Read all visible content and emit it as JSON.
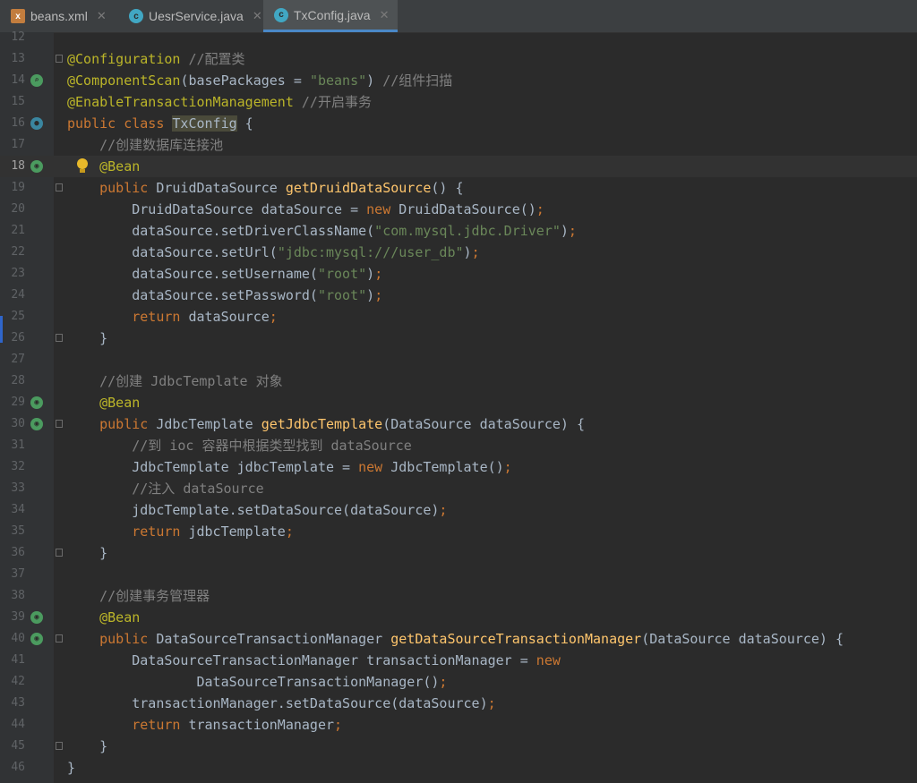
{
  "tabs": [
    {
      "label": "beans.xml",
      "icon": "xml-file-icon",
      "active": false
    },
    {
      "label": "UesrService.java",
      "icon": "class-icon",
      "active": false
    },
    {
      "label": "TxConfig.java",
      "icon": "class-icon",
      "active": true
    }
  ],
  "current_line": "18",
  "lines": [
    {
      "n": "12",
      "t": ""
    },
    {
      "n": "13",
      "t": "@Configuration //配置类"
    },
    {
      "n": "14",
      "t": "@ComponentScan(basePackages = \"beans\") //组件扫描"
    },
    {
      "n": "15",
      "t": "@EnableTransactionManagement //开启事务"
    },
    {
      "n": "16",
      "t": "public class TxConfig {"
    },
    {
      "n": "17",
      "t": "    //创建数据库连接池"
    },
    {
      "n": "18",
      "t": "    @Bean"
    },
    {
      "n": "19",
      "t": "    public DruidDataSource getDruidDataSource() {"
    },
    {
      "n": "20",
      "t": "        DruidDataSource dataSource = new DruidDataSource();"
    },
    {
      "n": "21",
      "t": "        dataSource.setDriverClassName(\"com.mysql.jdbc.Driver\");"
    },
    {
      "n": "22",
      "t": "        dataSource.setUrl(\"jdbc:mysql:///user_db\");"
    },
    {
      "n": "23",
      "t": "        dataSource.setUsername(\"root\");"
    },
    {
      "n": "24",
      "t": "        dataSource.setPassword(\"root\");"
    },
    {
      "n": "25",
      "t": "        return dataSource;"
    },
    {
      "n": "26",
      "t": "    }"
    },
    {
      "n": "27",
      "t": ""
    },
    {
      "n": "28",
      "t": "    //创建 JdbcTemplate 对象"
    },
    {
      "n": "29",
      "t": "    @Bean"
    },
    {
      "n": "30",
      "t": "    public JdbcTemplate getJdbcTemplate(DataSource dataSource) {"
    },
    {
      "n": "31",
      "t": "        //到 ioc 容器中根据类型找到 dataSource"
    },
    {
      "n": "32",
      "t": "        JdbcTemplate jdbcTemplate = new JdbcTemplate();"
    },
    {
      "n": "33",
      "t": "        //注入 dataSource"
    },
    {
      "n": "34",
      "t": "        jdbcTemplate.setDataSource(dataSource);"
    },
    {
      "n": "35",
      "t": "        return jdbcTemplate;"
    },
    {
      "n": "36",
      "t": "    }"
    },
    {
      "n": "37",
      "t": ""
    },
    {
      "n": "38",
      "t": "    //创建事务管理器"
    },
    {
      "n": "39",
      "t": "    @Bean"
    },
    {
      "n": "40",
      "t": "    public DataSourceTransactionManager getDataSourceTransactionManager(DataSource dataSource) {"
    },
    {
      "n": "41",
      "t": "        DataSourceTransactionManager transactionManager = new"
    },
    {
      "n": "42",
      "t": "                DataSourceTransactionManager();"
    },
    {
      "n": "43",
      "t": "        transactionManager.setDataSource(dataSource);"
    },
    {
      "n": "44",
      "t": "        return transactionManager;"
    },
    {
      "n": "45",
      "t": "    }"
    },
    {
      "n": "46",
      "t": "}"
    }
  ],
  "gutter_icons": {
    "14": "scan",
    "16": "cls",
    "18": "bean",
    "29": "bean",
    "30": "bean",
    "39": "bean",
    "40": "bean"
  },
  "fold_lines": [
    "13",
    "19",
    "26",
    "30",
    "36",
    "40",
    "45"
  ],
  "colors": {
    "keyword": "#cc7832",
    "annotation": "#bbb529",
    "string": "#6a8759",
    "comment": "#808080",
    "method": "#ffc66d",
    "text": "#a9b7c6"
  }
}
